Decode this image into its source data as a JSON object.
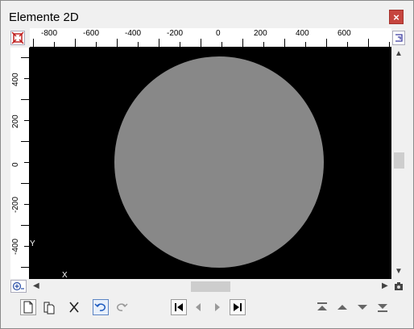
{
  "window": {
    "title": "Elemente 2D",
    "close_label": "×"
  },
  "ruler_x": {
    "tick_labels": [
      "-800",
      "-600",
      "-400",
      "-200",
      "0",
      "200",
      "400",
      "600"
    ]
  },
  "ruler_y": {
    "tick_labels": [
      "400",
      "200",
      "0",
      "-200",
      "-400"
    ]
  },
  "axes_indicator": {
    "x_label": "X",
    "y_label": "Y"
  },
  "viewport": {
    "background_color": "#000000",
    "shape": "circle",
    "shape_color": "#888888"
  },
  "toolbar": {
    "left_icons": [
      "new-document-icon",
      "copy-document-icon",
      "delete-icon",
      "undo-icon",
      "redo-icon"
    ],
    "nav_icons": [
      "first-icon",
      "previous-icon",
      "next-icon",
      "last-icon"
    ],
    "order_icons": [
      "move-top-icon",
      "move-up-icon",
      "move-down-icon",
      "move-bottom-icon"
    ]
  }
}
